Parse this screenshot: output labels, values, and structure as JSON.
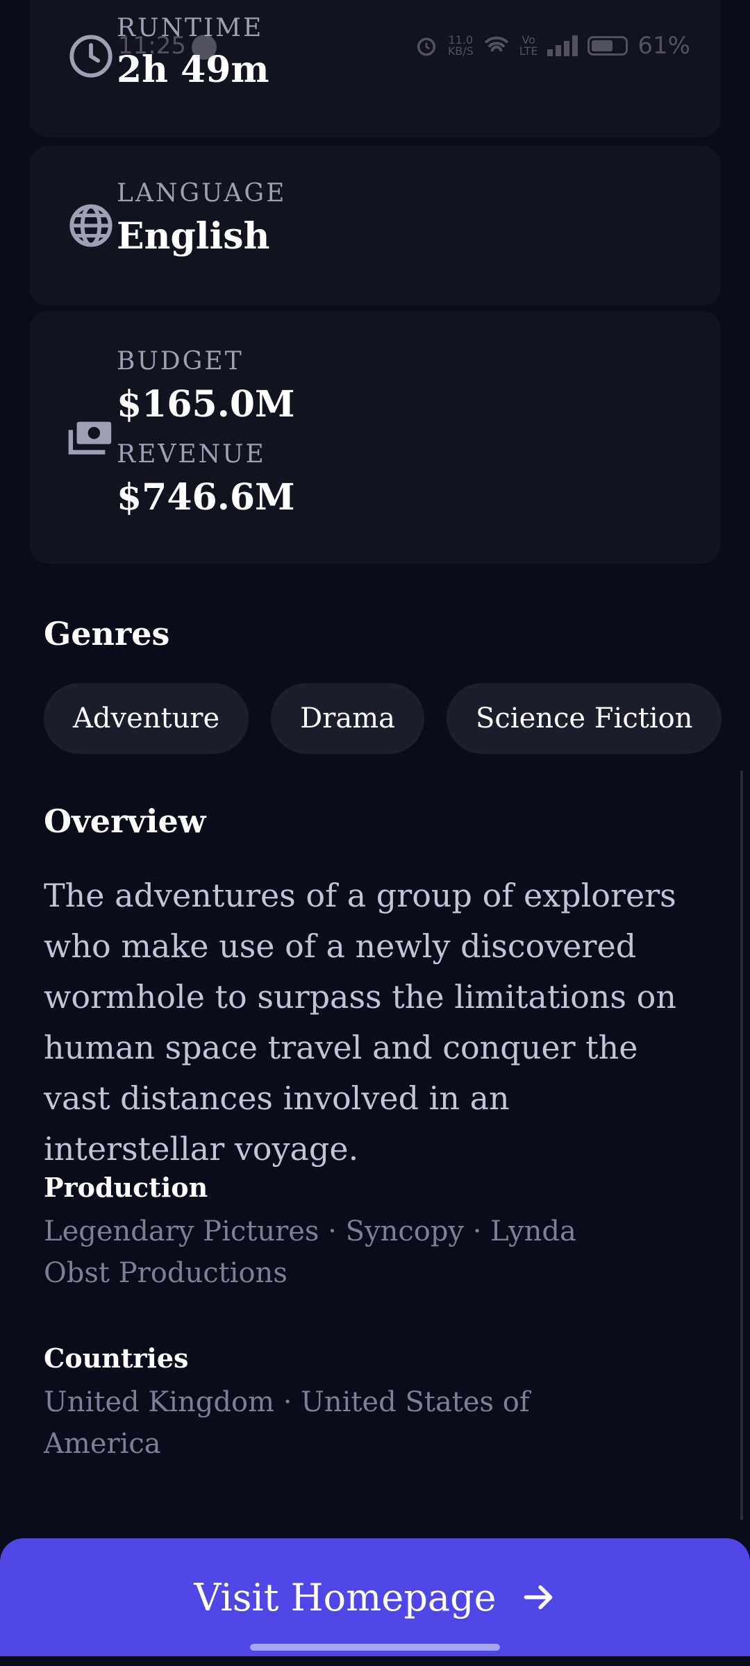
{
  "status_bar": {
    "time": "11:25",
    "data_speed_top": "11.0",
    "data_speed_unit": "KB/S",
    "volte_top": "Vo",
    "volte_bottom": "LTE",
    "battery": "61%"
  },
  "details": {
    "runtime": {
      "label": "RUNTIME",
      "value": "2h 49m",
      "icon": "clock-icon"
    },
    "language": {
      "label": "LANGUAGE",
      "value": "English",
      "icon": "globe-icon"
    },
    "money": {
      "icon": "money-icon",
      "budget_label": "BUDGET",
      "budget_value": "$165.0M",
      "revenue_label": "REVENUE",
      "revenue_value": "$746.6M"
    }
  },
  "genres": {
    "title": "Genres",
    "items": [
      "Adventure",
      "Drama",
      "Science Fiction"
    ]
  },
  "overview": {
    "title": "Overview",
    "text": "The adventures of a group of explorers who make use of a newly discovered wormhole to surpass the limitations on human space travel and conquer the vast distances involved in an interstellar voyage."
  },
  "production": {
    "title": "Production",
    "text": "Legendary Pictures · Syncopy · Lynda Obst Productions"
  },
  "countries": {
    "title": "Countries",
    "text": "United Kingdom · United States of America"
  },
  "cta": {
    "label": "Visit Homepage",
    "icon": "arrow-right-icon"
  },
  "colors": {
    "background": "#0b0c1a",
    "card": "#11131f",
    "chip": "#1c1e2c",
    "accent": "#4f46e5"
  }
}
